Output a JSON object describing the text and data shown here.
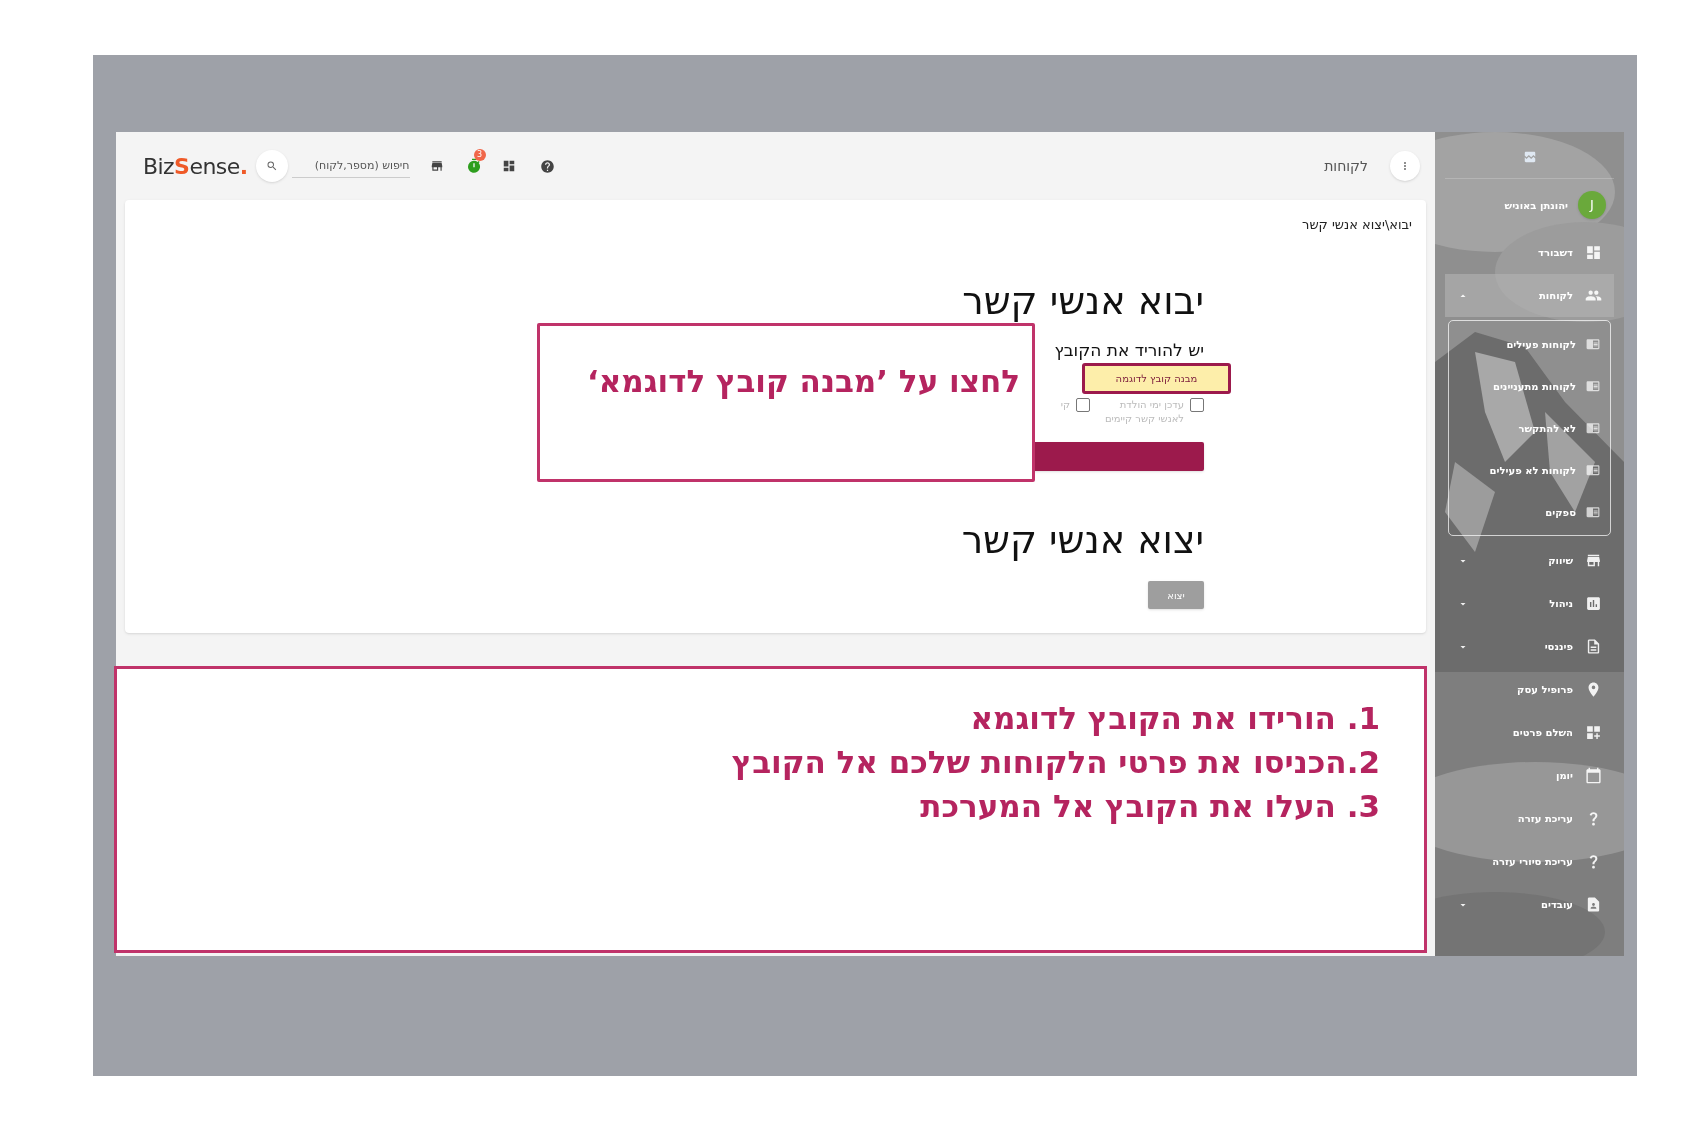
{
  "app": {
    "topbar": {
      "logo": {
        "start": "Biz",
        "accent_letter": "S",
        "rest": "ense",
        "accent_dot": "."
      },
      "search": {
        "placeholder": "חיפוש (מספר,לקוח)"
      },
      "timer_badge": "3",
      "page_title": "לקוחות"
    },
    "breadcrumb": "יבוא\\יצוא אנשי קשר",
    "import": {
      "title": "יבוא אנשי קשר",
      "instruction": "יש להוריד את הקובץ",
      "sample_button": "מבנה קובץ לדוגמה",
      "options": [
        {
          "label": "עדכן ימי הולדת לאנשי קשר קיימים",
          "checked": false
        },
        {
          "label": "קי",
          "checked": false
        }
      ]
    },
    "export": {
      "title": "יצוא אנשי קשר",
      "button": "יצוא"
    },
    "sidebar": {
      "user": {
        "initial": "J",
        "name": "יהונתן באוניש"
      },
      "items": [
        {
          "label": "דשבורד",
          "selected": false
        },
        {
          "label": "לקוחות",
          "selected": true,
          "expanded": true,
          "children": [
            {
              "label": "לקוחות פעילים"
            },
            {
              "label": "לקוחות מתעניינים"
            },
            {
              "label": "לא להתקשר"
            },
            {
              "label": "לקוחות לא פעילים"
            },
            {
              "label": "ספקים"
            }
          ]
        },
        {
          "label": "שיווק",
          "selected": false,
          "expanded": false
        },
        {
          "label": "ניהול",
          "selected": false,
          "expanded": false
        },
        {
          "label": "פיננסי",
          "selected": false,
          "expanded": false
        },
        {
          "label": "פרופיל עסק",
          "selected": false
        },
        {
          "label": "השלם פרטים",
          "selected": false
        },
        {
          "label": "יומן",
          "selected": false
        },
        {
          "label": "עריכת עזרה",
          "selected": false
        },
        {
          "label": "עריכת סיורי עזרה",
          "selected": false
        },
        {
          "label": "עובדים",
          "selected": false,
          "expanded": false
        }
      ]
    }
  },
  "callouts": {
    "tip": "לחצו על  ’מבנה קובץ לדוגמא‘",
    "steps": [
      "1. הורידו את הקובץ לדוגמא",
      "2.הכניסו את פרטי הלקוחות שלכם אל הקובץ",
      "3. העלו את הקובץ אל המערכת"
    ]
  }
}
